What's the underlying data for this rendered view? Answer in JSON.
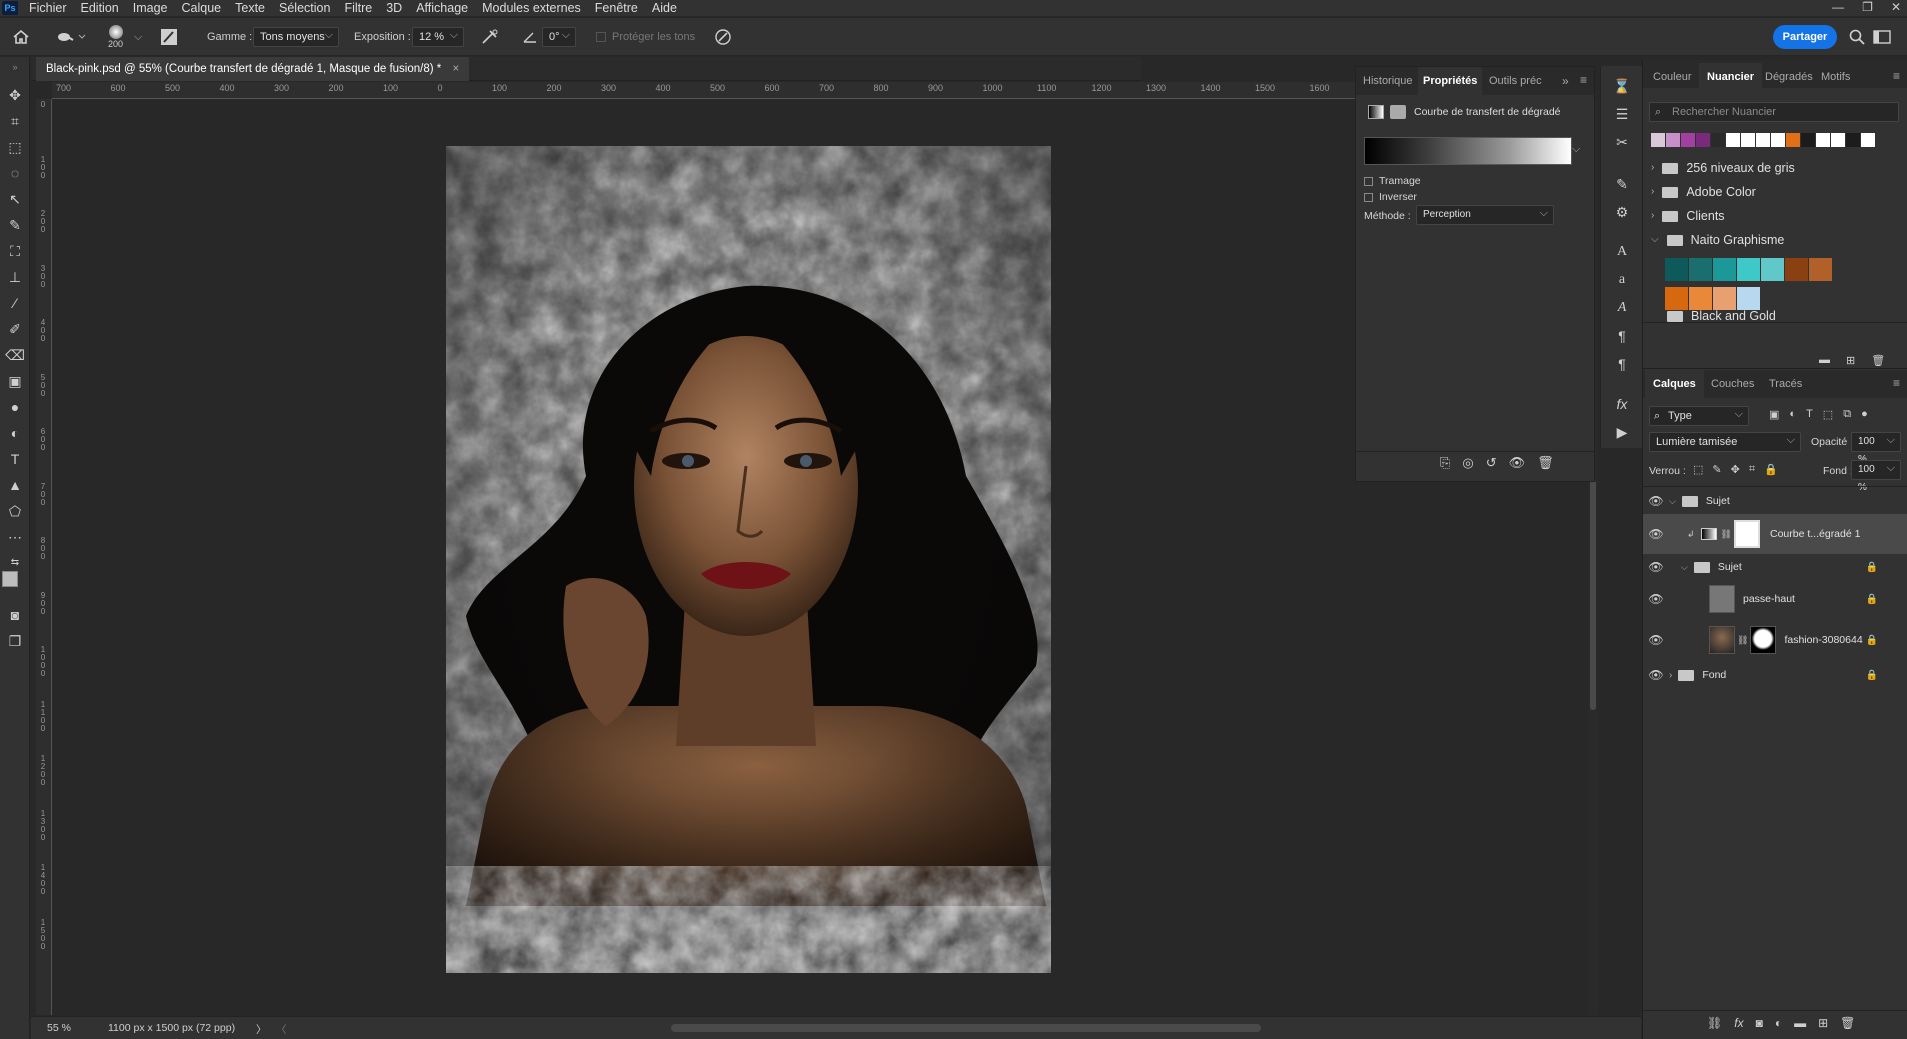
{
  "menubar": {
    "logo": "Ps",
    "items": [
      "Fichier",
      "Edition",
      "Image",
      "Calque",
      "Texte",
      "Sélection",
      "Filtre",
      "3D",
      "Affichage",
      "Modules externes",
      "Fenêtre",
      "Aide"
    ]
  },
  "window_controls": {
    "minimize": "—",
    "restore": "❐",
    "close": "✕"
  },
  "options": {
    "brush_size": "200",
    "range_label": "Gamme :",
    "range_value": "Tons moyens",
    "exposure_label": "Exposition :",
    "exposure_value": "12 %",
    "angle_value": "0°",
    "protect_tones": "Protéger les tons",
    "share": "Partager"
  },
  "document": {
    "tab_title": "Black-pink.psd @ 55% (Courbe transfert de dégradé 1, Masque de fusion/8) *",
    "close": "×"
  },
  "ruler": {
    "top": [
      "700",
      "600",
      "500",
      "400",
      "300",
      "200",
      "100",
      "0",
      "100",
      "200",
      "300",
      "400",
      "500",
      "600",
      "700",
      "800",
      "900",
      "1000",
      "1100",
      "1200",
      "1300",
      "1400",
      "1500",
      "1600"
    ],
    "left": [
      "0",
      "1 0 0",
      "2 0 0",
      "3 0 0",
      "4 0 0",
      "5 0 0",
      "6 0 0",
      "7 0 0",
      "8 0 0",
      "9 0 0",
      "1 0 0 0",
      "1 1 0 0",
      "1 2 0 0",
      "1 3 0 0",
      "1 4 0 0",
      "1 5 0 0"
    ]
  },
  "status": {
    "zoom": "55 %",
    "size": "1100 px x 1500 px (72 ppp)",
    "arrow": "〉",
    "left_arrow": "〈"
  },
  "properties": {
    "tabs": [
      "Historique",
      "Propriétés",
      "Outils préc"
    ],
    "active_tab": "Propriétés",
    "layer_type": "Courbe de transfert de dégradé",
    "dither": "Tramage",
    "reverse": "Inverser",
    "method_label": "Méthode :",
    "method_value": "Perception"
  },
  "swatches_panel": {
    "tabs": [
      "Couleur",
      "Nuancier",
      "Dégradés",
      "Motifs"
    ],
    "active_tab": "Nuancier",
    "search_placeholder": "Rechercher Nuancier",
    "recent_colors": [
      "#d8c8d8",
      "#c890c8",
      "#a040a0",
      "#7a2a7a",
      "#2a2a2a",
      "#ffffff",
      "#ffffff",
      "#ffffff",
      "#ffffff",
      "#e07018",
      "#1c1c1c",
      "#ffffff",
      "#ffffff",
      "#1c1c1c",
      "#ffffff"
    ],
    "groups": [
      "256 niveaux de gris",
      "Adobe Color",
      "Clients",
      "Naito Graphisme",
      "Black and Gold"
    ],
    "naito_colors_row1": [
      "#0e5a5a",
      "#1a6e6e",
      "#1c9898",
      "#3ec8c8",
      "#60c8c8",
      "#8a4010",
      "#b06028"
    ],
    "naito_colors_row2": [
      "#d86810",
      "#e88838",
      "#e8a070",
      "#b8d8f0"
    ]
  },
  "layers_panel": {
    "tabs": [
      "Calques",
      "Couches",
      "Tracés"
    ],
    "active_tab": "Calques",
    "filter": "Type",
    "blend_mode": "Lumière tamisée",
    "opacity_label": "Opacité :",
    "opacity_value": "100 %",
    "lock_label": "Verrou :",
    "fill_label": "Fond :",
    "fill_value": "100 %",
    "layers": [
      {
        "name": "Sujet",
        "kind": "group"
      },
      {
        "name": "Courbe t...égradé 1",
        "kind": "adjustment"
      },
      {
        "name": "Sujet",
        "kind": "group"
      },
      {
        "name": "passe-haut",
        "kind": "layer"
      },
      {
        "name": "fashion-3080644",
        "kind": "layer"
      },
      {
        "name": "Fond",
        "kind": "group"
      }
    ]
  }
}
